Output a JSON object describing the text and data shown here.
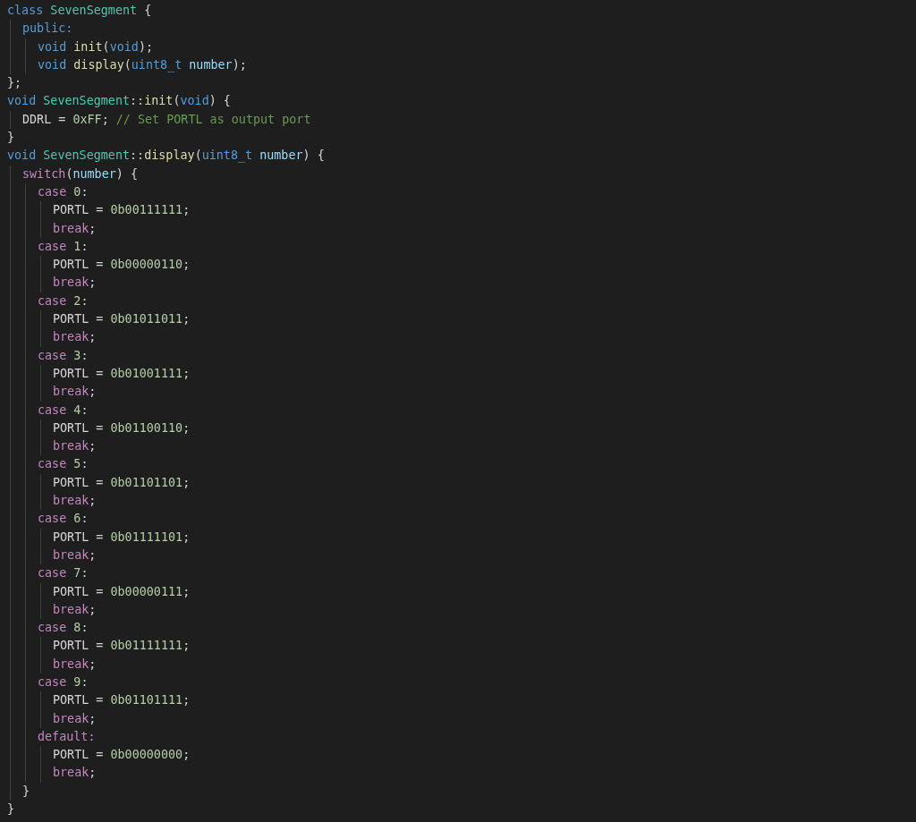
{
  "code": [
    {
      "tokens": [
        {
          "text": "class",
          "kind": "keyword"
        },
        {
          "text": " SevenSegment",
          "kind": "type"
        },
        {
          "text": " {",
          "kind": "plain"
        }
      ],
      "children": [
        {
          "tokens": [
            {
              "text": "public:",
              "kind": "keyword"
            }
          ],
          "children": [
            {
              "tokens": [
                {
                  "text": "void",
                  "kind": "keyword"
                },
                {
                  "text": " init",
                  "kind": "function"
                },
                {
                  "text": "(",
                  "kind": "plain"
                },
                {
                  "text": "void",
                  "kind": "keyword"
                },
                {
                  "text": ");",
                  "kind": "plain"
                }
              ]
            },
            {
              "tokens": [
                {
                  "text": "void",
                  "kind": "keyword"
                },
                {
                  "text": " display",
                  "kind": "function"
                },
                {
                  "text": "(",
                  "kind": "plain"
                },
                {
                  "text": "uint8_t",
                  "kind": "keyword"
                },
                {
                  "text": " number",
                  "kind": "variable"
                },
                {
                  "text": ");",
                  "kind": "plain"
                }
              ]
            }
          ]
        }
      ]
    },
    {
      "tokens": [
        {
          "text": "};",
          "kind": "plain"
        }
      ]
    },
    {
      "tokens": [
        {
          "text": "void",
          "kind": "keyword"
        },
        {
          "text": " SevenSegment",
          "kind": "type"
        },
        {
          "text": "::",
          "kind": "plain"
        },
        {
          "text": "init",
          "kind": "function"
        },
        {
          "text": "(",
          "kind": "plain"
        },
        {
          "text": "void",
          "kind": "keyword"
        },
        {
          "text": ") {",
          "kind": "plain"
        }
      ],
      "children": [
        {
          "tokens": [
            {
              "text": "DDRL =",
              "kind": "plain"
            },
            {
              "text": " 0xFF",
              "kind": "number"
            },
            {
              "text": ";",
              "kind": "plain"
            },
            {
              "text": " // Set PORTL as output port",
              "kind": "comment"
            }
          ]
        }
      ]
    },
    {
      "tokens": [
        {
          "text": "}",
          "kind": "plain"
        }
      ]
    },
    {
      "tokens": [
        {
          "text": "void",
          "kind": "keyword"
        },
        {
          "text": " SevenSegment",
          "kind": "type"
        },
        {
          "text": "::",
          "kind": "plain"
        },
        {
          "text": "display",
          "kind": "function"
        },
        {
          "text": "(",
          "kind": "plain"
        },
        {
          "text": "uint8_t",
          "kind": "keyword"
        },
        {
          "text": " number",
          "kind": "variable"
        },
        {
          "text": ") {",
          "kind": "plain"
        }
      ],
      "children": [
        {
          "tokens": [
            {
              "text": "switch",
              "kind": "control"
            },
            {
              "text": "(",
              "kind": "plain"
            },
            {
              "text": "number",
              "kind": "variable"
            },
            {
              "text": ") {",
              "kind": "plain"
            }
          ],
          "children": [
            {
              "tokens": [
                {
                  "text": "case",
                  "kind": "control"
                },
                {
                  "text": " 0",
                  "kind": "number"
                },
                {
                  "text": ":",
                  "kind": "plain"
                }
              ],
              "children": [
                {
                  "tokens": [
                    {
                      "text": "PORTL =",
                      "kind": "plain"
                    },
                    {
                      "text": " 0b00111111",
                      "kind": "number"
                    },
                    {
                      "text": ";",
                      "kind": "plain"
                    }
                  ]
                },
                {
                  "tokens": [
                    {
                      "text": "break",
                      "kind": "control"
                    },
                    {
                      "text": ";",
                      "kind": "plain"
                    }
                  ]
                }
              ]
            },
            {
              "tokens": [
                {
                  "text": "case",
                  "kind": "control"
                },
                {
                  "text": " 1",
                  "kind": "number"
                },
                {
                  "text": ":",
                  "kind": "plain"
                }
              ],
              "children": [
                {
                  "tokens": [
                    {
                      "text": "PORTL =",
                      "kind": "plain"
                    },
                    {
                      "text": " 0b00000110",
                      "kind": "number"
                    },
                    {
                      "text": ";",
                      "kind": "plain"
                    }
                  ]
                },
                {
                  "tokens": [
                    {
                      "text": "break",
                      "kind": "control"
                    },
                    {
                      "text": ";",
                      "kind": "plain"
                    }
                  ]
                }
              ]
            },
            {
              "tokens": [
                {
                  "text": "case",
                  "kind": "control"
                },
                {
                  "text": " 2",
                  "kind": "number"
                },
                {
                  "text": ":",
                  "kind": "plain"
                }
              ],
              "children": [
                {
                  "tokens": [
                    {
                      "text": "PORTL =",
                      "kind": "plain"
                    },
                    {
                      "text": " 0b01011011",
                      "kind": "number"
                    },
                    {
                      "text": ";",
                      "kind": "plain"
                    }
                  ]
                },
                {
                  "tokens": [
                    {
                      "text": "break",
                      "kind": "control"
                    },
                    {
                      "text": ";",
                      "kind": "plain"
                    }
                  ]
                }
              ]
            },
            {
              "tokens": [
                {
                  "text": "case",
                  "kind": "control"
                },
                {
                  "text": " 3",
                  "kind": "number"
                },
                {
                  "text": ":",
                  "kind": "plain"
                }
              ],
              "children": [
                {
                  "tokens": [
                    {
                      "text": "PORTL =",
                      "kind": "plain"
                    },
                    {
                      "text": " 0b01001111",
                      "kind": "number"
                    },
                    {
                      "text": ";",
                      "kind": "plain"
                    }
                  ]
                },
                {
                  "tokens": [
                    {
                      "text": "break",
                      "kind": "control"
                    },
                    {
                      "text": ";",
                      "kind": "plain"
                    }
                  ]
                }
              ]
            },
            {
              "tokens": [
                {
                  "text": "case",
                  "kind": "control"
                },
                {
                  "text": " 4",
                  "kind": "number"
                },
                {
                  "text": ":",
                  "kind": "plain"
                }
              ],
              "children": [
                {
                  "tokens": [
                    {
                      "text": "PORTL =",
                      "kind": "plain"
                    },
                    {
                      "text": " 0b01100110",
                      "kind": "number"
                    },
                    {
                      "text": ";",
                      "kind": "plain"
                    }
                  ]
                },
                {
                  "tokens": [
                    {
                      "text": "break",
                      "kind": "control"
                    },
                    {
                      "text": ";",
                      "kind": "plain"
                    }
                  ]
                }
              ]
            },
            {
              "tokens": [
                {
                  "text": "case",
                  "kind": "control"
                },
                {
                  "text": " 5",
                  "kind": "number"
                },
                {
                  "text": ":",
                  "kind": "plain"
                }
              ],
              "children": [
                {
                  "tokens": [
                    {
                      "text": "PORTL =",
                      "kind": "plain"
                    },
                    {
                      "text": " 0b01101101",
                      "kind": "number"
                    },
                    {
                      "text": ";",
                      "kind": "plain"
                    }
                  ]
                },
                {
                  "tokens": [
                    {
                      "text": "break",
                      "kind": "control"
                    },
                    {
                      "text": ";",
                      "kind": "plain"
                    }
                  ]
                }
              ]
            },
            {
              "tokens": [
                {
                  "text": "case",
                  "kind": "control"
                },
                {
                  "text": " 6",
                  "kind": "number"
                },
                {
                  "text": ":",
                  "kind": "plain"
                }
              ],
              "children": [
                {
                  "tokens": [
                    {
                      "text": "PORTL =",
                      "kind": "plain"
                    },
                    {
                      "text": " 0b01111101",
                      "kind": "number"
                    },
                    {
                      "text": ";",
                      "kind": "plain"
                    }
                  ]
                },
                {
                  "tokens": [
                    {
                      "text": "break",
                      "kind": "control"
                    },
                    {
                      "text": ";",
                      "kind": "plain"
                    }
                  ]
                }
              ]
            },
            {
              "tokens": [
                {
                  "text": "case",
                  "kind": "control"
                },
                {
                  "text": " 7",
                  "kind": "number"
                },
                {
                  "text": ":",
                  "kind": "plain"
                }
              ],
              "children": [
                {
                  "tokens": [
                    {
                      "text": "PORTL =",
                      "kind": "plain"
                    },
                    {
                      "text": " 0b00000111",
                      "kind": "number"
                    },
                    {
                      "text": ";",
                      "kind": "plain"
                    }
                  ]
                },
                {
                  "tokens": [
                    {
                      "text": "break",
                      "kind": "control"
                    },
                    {
                      "text": ";",
                      "kind": "plain"
                    }
                  ]
                }
              ]
            },
            {
              "tokens": [
                {
                  "text": "case",
                  "kind": "control"
                },
                {
                  "text": " 8",
                  "kind": "number"
                },
                {
                  "text": ":",
                  "kind": "plain"
                }
              ],
              "children": [
                {
                  "tokens": [
                    {
                      "text": "PORTL =",
                      "kind": "plain"
                    },
                    {
                      "text": " 0b01111111",
                      "kind": "number"
                    },
                    {
                      "text": ";",
                      "kind": "plain"
                    }
                  ]
                },
                {
                  "tokens": [
                    {
                      "text": "break",
                      "kind": "control"
                    },
                    {
                      "text": ";",
                      "kind": "plain"
                    }
                  ]
                }
              ]
            },
            {
              "tokens": [
                {
                  "text": "case",
                  "kind": "control"
                },
                {
                  "text": " 9",
                  "kind": "number"
                },
                {
                  "text": ":",
                  "kind": "plain"
                }
              ],
              "children": [
                {
                  "tokens": [
                    {
                      "text": "PORTL =",
                      "kind": "plain"
                    },
                    {
                      "text": " 0b01101111",
                      "kind": "number"
                    },
                    {
                      "text": ";",
                      "kind": "plain"
                    }
                  ]
                },
                {
                  "tokens": [
                    {
                      "text": "break",
                      "kind": "control"
                    },
                    {
                      "text": ";",
                      "kind": "plain"
                    }
                  ]
                }
              ]
            },
            {
              "tokens": [
                {
                  "text": "default:",
                  "kind": "control"
                }
              ],
              "children": [
                {
                  "tokens": [
                    {
                      "text": "PORTL =",
                      "kind": "plain"
                    },
                    {
                      "text": " 0b00000000",
                      "kind": "number"
                    },
                    {
                      "text": ";",
                      "kind": "plain"
                    }
                  ]
                },
                {
                  "tokens": [
                    {
                      "text": "break",
                      "kind": "control"
                    },
                    {
                      "text": ";",
                      "kind": "plain"
                    }
                  ]
                }
              ]
            }
          ]
        },
        {
          "tokens": [
            {
              "text": "}",
              "kind": "plain"
            }
          ]
        }
      ]
    },
    {
      "tokens": [
        {
          "text": "}",
          "kind": "plain"
        }
      ]
    }
  ]
}
